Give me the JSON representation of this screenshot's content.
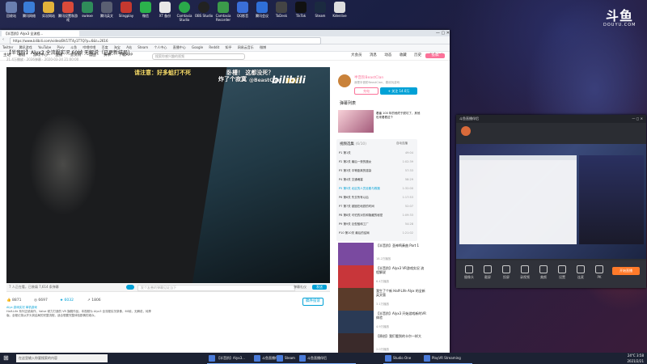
{
  "desktop": {
    "icons": [
      "回收站",
      "腾讯网络",
      "实况网站",
      "腾讯设置和游戏",
      "swiexe",
      "腾讯英文",
      "Slingplay",
      "BiliBiliBetaClient",
      "微信",
      "XT 备份",
      "Camtasia Studio",
      "OBS Studio",
      "Camtasia Recorder",
      "QQ影音",
      "腾讯会议",
      "ToDesk",
      "Steam",
      "TikTok",
      "Kdenlive"
    ],
    "douyu_logo": "斗鱼",
    "douyu_sub": "DOUYU.COM"
  },
  "browser": {
    "tab_title": "【半音阶】Alyx3 全流程...",
    "address": "https://www.bilibili.com/video/BV17T4y1T7Q?p=6&t=2616",
    "bookmarks": [
      "Twitter",
      "腾讯游戏",
      "YouTube",
      "Pixiv",
      "斗鱼",
      "哔哩哔哩",
      "百度",
      "淘宝",
      "A站",
      "Steam",
      "个人中心",
      "直播中心",
      "Google",
      "Reddit",
      "知乎",
      "网易云音乐",
      "微博"
    ],
    "nav": {
      "items": [
        "主站",
        "番剧",
        "游戏中心",
        "直播",
        "会员购",
        "漫画",
        "赛事",
        "下载APP"
      ],
      "search_placeholder": "搜索你感兴趣的视频",
      "right_items": [
        "大会员",
        "消息",
        "动态",
        "收藏",
        "历史",
        "创作中心"
      ],
      "upload_label": "投稿"
    },
    "video": {
      "title": "【半音阶】Alyx3 全流程实况 60帧 无解说（已更新结局）",
      "meta": "21.4万播放 · 2036弹幕 · 2020-03-24 21:00:00",
      "danmaku": [
        "请注意：好多蛆打不死",
        "卧槽！ 这都没死？",
        "炸了个寂寞",
        "刷新了"
      ],
      "watermark": "bilibili",
      "uploader_watermark": "@BeastClan",
      "viewer_count": "7 人正在看，已装填 7,614 条弹幕",
      "danmaku_placeholder": "发个友善的弹幕见证当下",
      "etiquette": "弹幕礼仪",
      "send": "发送",
      "likes": "8871",
      "coins": "6697",
      "favorites": "6032",
      "shares": "1806",
      "report": "稿件投诉",
      "tags": "Alyx 游戏实况 单机游戏",
      "description": "Half-Life 系列正统续作，Valve 倾力打造的 VR 旗舰作品。本视频为 Alyx3 全流程实况录像，60帧，无解说，纯享版。全程记录从开头到结局的完整流程，适合想要完整体验剧情的观众。"
    },
    "uploader": {
      "name": "半音阶BeastClan",
      "desc": "我是半音阶BeastClan，喜欢玩游戏",
      "charge": "充电",
      "follow": "+ 关注 14.0万"
    },
    "ad": {
      "label": "弹幕列表",
      "text": "看番 100 年的他终于脱坑了，其他也来看看这个"
    },
    "playlist": {
      "title": "视频选集",
      "count": "(6/10)",
      "autoplay": "自动连播",
      "items": [
        {
          "label": "P1 第1关",
          "dur": "49:04"
        },
        {
          "label": "P2 第2关 最后一夜的魔女",
          "dur": "1:02:39"
        },
        {
          "label": "P3 第3关 中等距离的感染",
          "dur": "57:33"
        },
        {
          "label": "P4 第4关 交通堵塞",
          "dur": "58:29"
        },
        {
          "label": "P5 第5关 北区的人员走散与救援",
          "dur": "1:32:00"
        },
        {
          "label": "P6 第6关 失去所有以后",
          "dur": "1:17:53"
        },
        {
          "label": "P7 第7关 被困在地铁的时间",
          "dur": "52:07"
        },
        {
          "label": "P8 第8关 可怕的对抗和隐藏的秘密",
          "dur": "1:09:33"
        },
        {
          "label": "P9 第9关 巨型蛆和工厂",
          "dur": "54:28"
        },
        {
          "label": "P10 第10关 最后的结局",
          "dur": "1:21:02"
        }
      ],
      "active_index": 4
    },
    "recommendations": [
      {
        "title": "【半音阶】圣神鸣奏曲 Part 1",
        "meta": "18.2万播放",
        "color": "#7a4aa0"
      },
      {
        "title": "【半音阶】Alyx3 VR游戏实况 流程解说",
        "meta": "6.4万播放",
        "color": "#c8363a"
      },
      {
        "title": "我生了个新 Half-Life Alyx 的全新英文版",
        "meta": "3.1万播放",
        "color": "#5a3b2a"
      },
      {
        "title": "【半音阶】Alyx3 开始游戏新的VR体验",
        "meta": "4.9万播放",
        "color": "#2a3a55"
      },
      {
        "title": "【原创】我们看到的卡尔一样大",
        "meta": "2.0万播放",
        "color": "#3a2a2a"
      }
    ]
  },
  "obs": {
    "title": "斗鱼直播伴侣",
    "tools": [
      "摄像头",
      "截屏",
      "投屏",
      "录视频",
      "美颜",
      "设置",
      "连麦",
      "PK"
    ],
    "start_live": "开始直播"
  },
  "taskbar": {
    "search_placeholder": "在这里输入你要搜索的内容",
    "apps": [
      "【半音阶】Alyx3...",
      "斗鱼直播伴侣",
      "Steam",
      "斗鱼直播伴侣",
      "Studio One",
      "PlayVR Streaming"
    ],
    "tray_time": "3:58",
    "tray_date": "2021/2/21",
    "temperature": "24°C"
  }
}
